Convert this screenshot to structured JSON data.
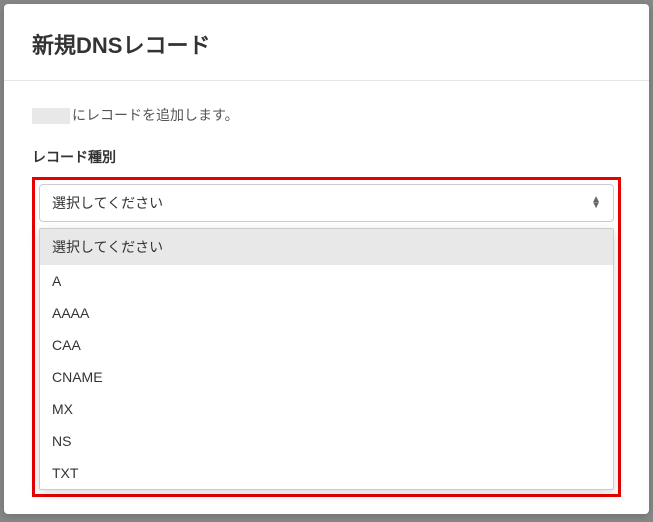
{
  "modal": {
    "title": "新規DNSレコード",
    "description_suffix": "にレコードを追加します。",
    "field_label": "レコード種別",
    "select": {
      "selected": "選択してください",
      "options": [
        "選択してください",
        "A",
        "AAAA",
        "CAA",
        "CNAME",
        "MX",
        "NS",
        "TXT"
      ]
    }
  }
}
